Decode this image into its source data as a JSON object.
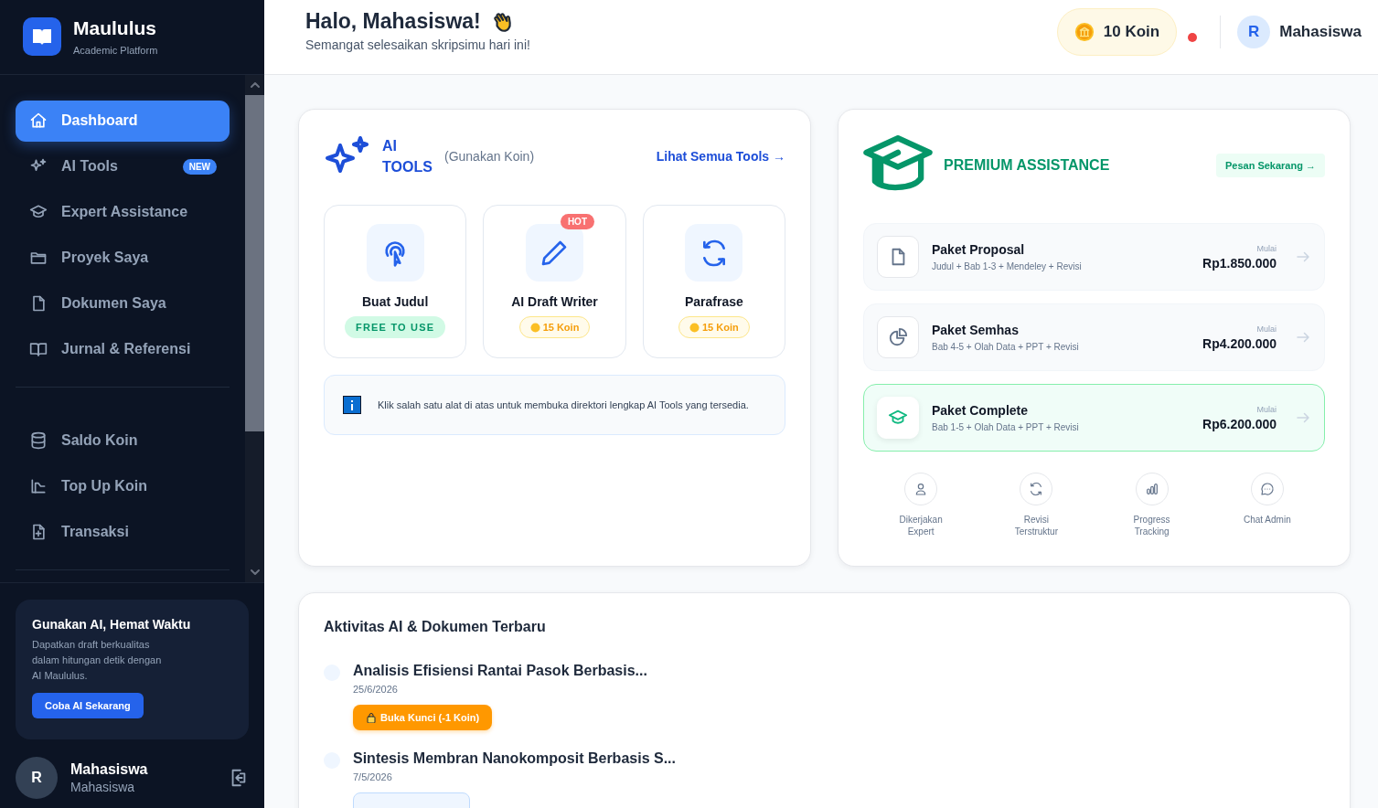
{
  "brand": {
    "name": "Maululus",
    "tagline": "Academic Platform"
  },
  "nav": [
    {
      "label": "Dashboard",
      "selected": true
    },
    {
      "label": "AI Tools",
      "selected": false,
      "badge": "NEW"
    },
    {
      "label": "Expert Assistance",
      "selected": false
    },
    {
      "label": "Proyek Saya",
      "selected": false
    },
    {
      "label": "Dokumen Saya",
      "selected": false
    },
    {
      "label": "Jurnal & Referensi",
      "selected": false
    }
  ],
  "nav_secondary": [
    {
      "label": "Saldo Koin",
      "selected": false
    },
    {
      "label": "Top Up Koin",
      "selected": false
    },
    {
      "label": "Transaksi",
      "selected": false
    }
  ],
  "promo": {
    "title": "Gunakan AI, Hemat Waktu",
    "text": "Dapatkan draft berkualitas dalam hitungan detik dengan AI Maululus.",
    "button": "Coba AI Sekarang"
  },
  "sidebar_user": {
    "initial": "R",
    "name": "Mahasiswa",
    "role": "Mahasiswa"
  },
  "header": {
    "greeting": "Halo, Mahasiswa!",
    "subtitle": "Semangat selesaikan skripsimu hari ini!",
    "coins": "10 Koin",
    "notification": true,
    "user": {
      "initial": "R",
      "name": "Mahasiswa"
    }
  },
  "ai_tools": {
    "title": "AI TOOLS",
    "note": "(Gunakan Koin)",
    "link": "Lihat Semua Tools →",
    "tools": [
      {
        "name": "Buat Judul",
        "price": {
          "kind": "free",
          "label": "FREE TO USE"
        }
      },
      {
        "name": "AI Draft Writer",
        "badge": "HOT",
        "price": {
          "kind": "coin",
          "label": "15 Koin"
        }
      },
      {
        "name": "Parafrase",
        "price": {
          "kind": "coin",
          "label": "15 Koin"
        }
      }
    ],
    "info": "Klik salah satu alat di atas untuk membuka direktori lengkap AI Tools yang tersedia."
  },
  "premium": {
    "title": "PREMIUM ASSISTANCE",
    "cta": "Pesan Sekarang →",
    "packages": [
      {
        "name": "Paket Proposal",
        "description": "Judul + Bab 1-3 + Mendeley + Revisi",
        "from": "Mulai",
        "price": "Rp1.850.000",
        "highlighted": false
      },
      {
        "name": "Paket Semhas",
        "description": "Bab 4-5 + Olah Data + PPT + Revisi",
        "from": "Mulai",
        "price": "Rp4.200.000",
        "highlighted": false
      },
      {
        "name": "Paket Complete",
        "description": "Bab 1-5 + Olah Data + PPT + Revisi",
        "from": "Mulai",
        "price": "Rp6.200.000",
        "highlighted": true
      }
    ],
    "features": [
      {
        "label": "Dikerjakan Expert"
      },
      {
        "label": "Revisi Terstruktur"
      },
      {
        "label": "Progress Tracking"
      },
      {
        "label": "Chat Admin"
      }
    ]
  },
  "activity": {
    "title": "Aktivitas AI & Dokumen Terbaru",
    "items": [
      {
        "title": "Analisis Efisiensi Rantai Pasok Berbasis...",
        "date": "25/6/2026",
        "action": {
          "kind": "unlock",
          "label": "Buka Kunci (-1 Koin)"
        }
      },
      {
        "title": "Sintesis Membran Nanokomposit Berbasis S...",
        "date": "7/5/2026",
        "action": {
          "kind": "open"
        }
      }
    ]
  }
}
